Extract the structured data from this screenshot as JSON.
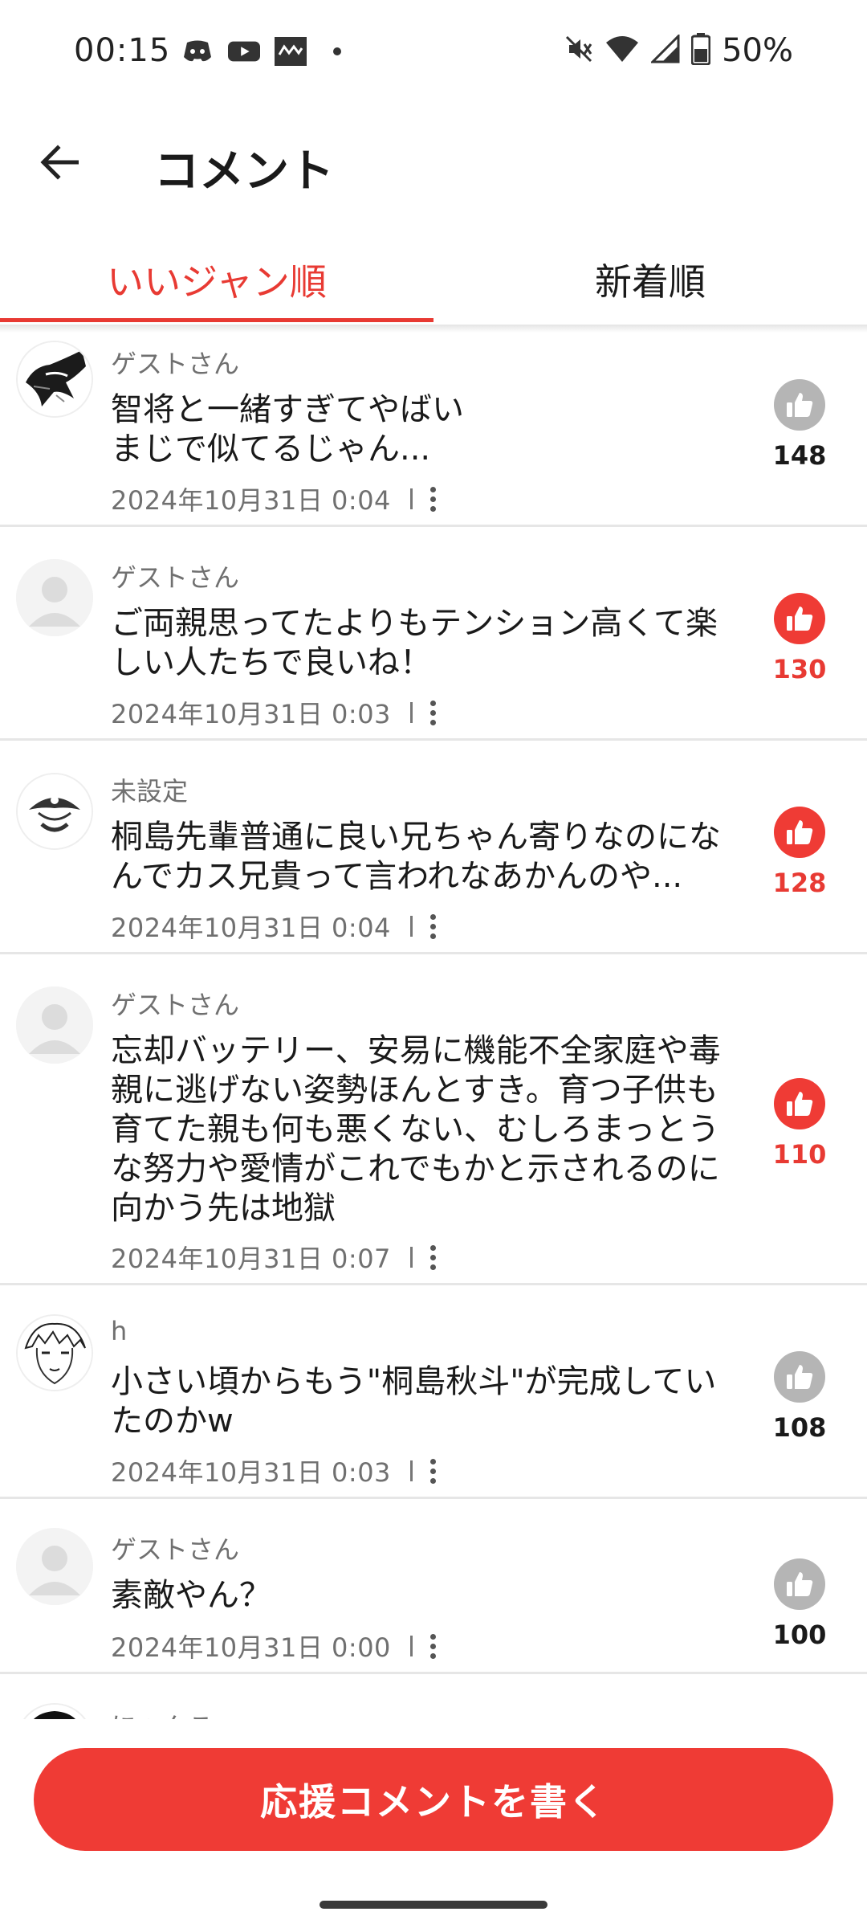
{
  "status_bar": {
    "time": "00:15",
    "battery": "50%",
    "icons_left": [
      "discord-icon",
      "youtube-icon",
      "app-icon",
      "dot-icon"
    ],
    "icons_right": [
      "mute-icon",
      "wifi-icon",
      "signal-icon",
      "battery-icon"
    ]
  },
  "header": {
    "title": "コメント",
    "back_icon": "arrow-left-icon"
  },
  "tabs": [
    {
      "label": "いいジャン順",
      "active": true
    },
    {
      "label": "新着順",
      "active": false
    }
  ],
  "colors": {
    "accent": "#e83a33",
    "like_active": "#ef3b35",
    "like_inactive": "#b5b5b5",
    "text_secondary": "#707070"
  },
  "comments": [
    {
      "user": "ゲストさん",
      "avatar": "manga-character-avatar",
      "lines": [
        "智将と一緒すぎてやばい",
        "まじで似てるじゃん..."
      ],
      "date": "2024年10月31日 0:04",
      "likes": "148",
      "liked": false
    },
    {
      "user": "ゲストさん",
      "avatar": "default-person-avatar",
      "lines": [
        "ご両親思ってたよりもテンション高くて楽",
        "しい人たちで良いね！"
      ],
      "date": "2024年10月31日 0:03",
      "likes": "130",
      "liked": true
    },
    {
      "user": "未設定",
      "avatar": "pirate-avatar",
      "lines": [
        "桐島先輩普通に良い兄ちゃん寄りなのにな",
        "んでカス兄貴って言われなあかんのや..."
      ],
      "date": "2024年10月31日 0:04",
      "likes": "128",
      "liked": true
    },
    {
      "user": "ゲストさん",
      "avatar": "default-person-avatar",
      "lines": [
        "忘却バッテリー、安易に機能不全家庭や毒",
        "親に逃げない姿勢ほんとすき。育つ子供も",
        "育てた親も何も悪くない、むしろまっとう",
        "な努力や愛情がこれでもかと示されるのに",
        "向かう先は地獄"
      ],
      "date": "2024年10月31日 0:07",
      "likes": "110",
      "liked": true
    },
    {
      "user": "h",
      "avatar": "manga-face-avatar",
      "lines": [
        "小さい頃からもう\"桐島秋斗\"が完成してい",
        "たのかw"
      ],
      "date": "2024年10月31日 0:03",
      "likes": "108",
      "liked": false
    },
    {
      "user": "ゲストさん",
      "avatar": "default-person-avatar",
      "lines": [
        "素敵やん？"
      ],
      "date": "2024年10月31日 0:00",
      "likes": "100",
      "liked": false
    },
    {
      "user": "にゃんこ",
      "avatar": "dark-hair-avatar",
      "lines": [],
      "date": "",
      "likes": "",
      "liked": false
    }
  ],
  "cta": {
    "label": "応援コメントを書く"
  }
}
